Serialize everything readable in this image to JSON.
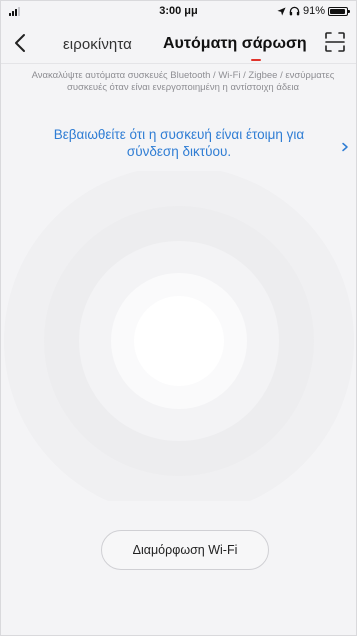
{
  "status_bar": {
    "time": "3:00 μμ",
    "battery_text": "91%",
    "battery_level": 0.91
  },
  "nav": {
    "prev_tab_label": "ειροκίνητα",
    "active_tab_label": "Αυτόματη σάρωση",
    "accent_color": "#e0332b"
  },
  "content": {
    "description": "Ανακαλύψτε αυτόματα συσκευές Bluetooth / Wi-Fi / Zigbee / ενσύρματες συσκευές όταν είναι ενεργοποιημένη η αντίστοιχη άδεια",
    "ready_link_line1": "Βεβαιωθείτε ότι η συσκευή είναι έτοιμη για",
    "ready_link_line2": "σύνδεση δικτύου.",
    "link_color": "#2f7dd4"
  },
  "actions": {
    "wifi_config_label": "Διαμόρφωση Wi-Fi"
  },
  "icons": {
    "back": "back-chevron-icon",
    "scan": "scan-icon",
    "location": "location-arrow-icon",
    "headphones": "headphones-icon",
    "battery": "battery-icon",
    "signal": "signal-icon"
  }
}
